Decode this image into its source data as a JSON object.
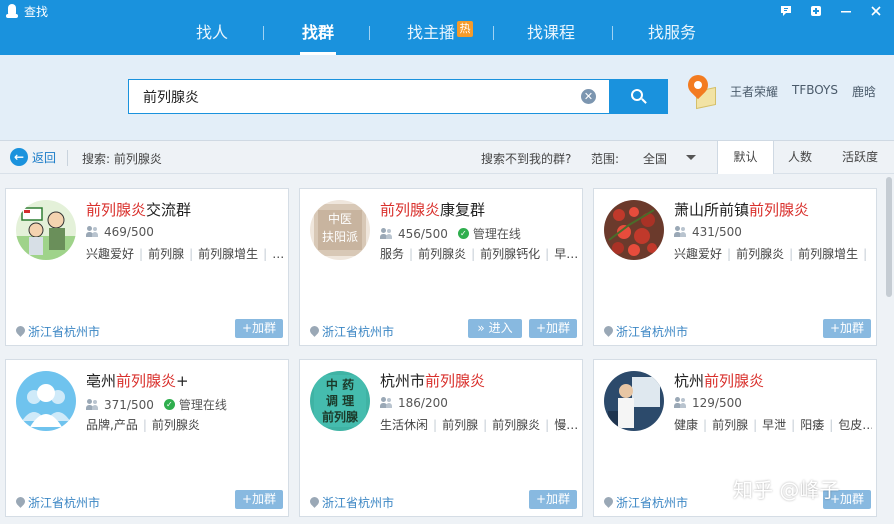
{
  "window": {
    "title": "查找"
  },
  "nav": {
    "items": [
      {
        "label": "找人"
      },
      {
        "label": "找群"
      },
      {
        "label": "找主播",
        "badge": "热"
      },
      {
        "label": "找课程"
      },
      {
        "label": "找服务"
      }
    ]
  },
  "search": {
    "value": "前列腺炎"
  },
  "hot_tags": [
    "王者荣耀",
    "TFBOYS",
    "鹿晗"
  ],
  "filter": {
    "back_label": "返回",
    "summary": "搜索: 前列腺炎",
    "not_found": "搜索不到我的群?",
    "range_label": "范围:",
    "range_value": "全国",
    "sort_tabs": [
      "默认",
      "人数",
      "活跃度"
    ]
  },
  "groups": [
    {
      "name_pre": "",
      "name_hl": "前列腺炎",
      "name_post": "交流群",
      "members": "469/500",
      "admin_online": "",
      "tags": [
        "兴趣爱好",
        "前列腺",
        "前列腺增生",
        "…"
      ],
      "location": "浙江省杭州市",
      "join_label": "+加群",
      "enter_label": "",
      "avatar": "cartoon"
    },
    {
      "name_pre": "",
      "name_hl": "前列腺炎",
      "name_post": "康复群",
      "members": "456/500",
      "admin_online": "管理在线",
      "tags": [
        "服务",
        "前列腺炎",
        "前列腺钙化",
        "早…"
      ],
      "location": "浙江省杭州市",
      "join_label": "+加群",
      "enter_label": "» 进入",
      "avatar": "chinese-medicine",
      "avatar_text": [
        "中医",
        "扶阳派"
      ]
    },
    {
      "name_pre": "萧山所前镇",
      "name_hl": "前列腺炎",
      "name_post": "",
      "members": "431/500",
      "admin_online": "",
      "tags": [
        "兴趣爱好",
        "前列腺炎",
        "前列腺增生",
        "…"
      ],
      "location": "浙江省杭州市",
      "join_label": "+加群",
      "enter_label": "",
      "avatar": "berries"
    },
    {
      "name_pre": "亳州",
      "name_hl": "前列腺炎",
      "name_post": "+",
      "members": "371/500",
      "admin_online": "管理在线",
      "tags": [
        "品牌,产品",
        "前列腺炎"
      ],
      "location": "浙江省杭州市",
      "join_label": "+加群",
      "enter_label": "",
      "avatar": "default-group"
    },
    {
      "name_pre": "杭州市",
      "name_hl": "前列腺炎",
      "name_post": "",
      "members": "186/200",
      "admin_online": "",
      "tags": [
        "生活休闲",
        "前列腺",
        "前列腺炎",
        "慢…"
      ],
      "location": "浙江省杭州市",
      "join_label": "+加群",
      "enter_label": "",
      "avatar": "calligraphy",
      "avatar_text": [
        "中",
        "药",
        "调",
        "理",
        "前",
        "列",
        "腺"
      ]
    },
    {
      "name_pre": "杭州",
      "name_hl": "前列腺炎",
      "name_post": "",
      "members": "129/500",
      "admin_online": "",
      "tags": [
        "健康",
        "前列腺",
        "早泄",
        "阳痿",
        "包皮…"
      ],
      "location": "浙江省杭州市",
      "join_label": "+加群",
      "enter_label": "",
      "avatar": "photo"
    }
  ],
  "watermark": "知乎 @峰子",
  "colors": {
    "brand": "#1a92dd",
    "highlight": "#d9302c",
    "location": "#3b86c4"
  }
}
